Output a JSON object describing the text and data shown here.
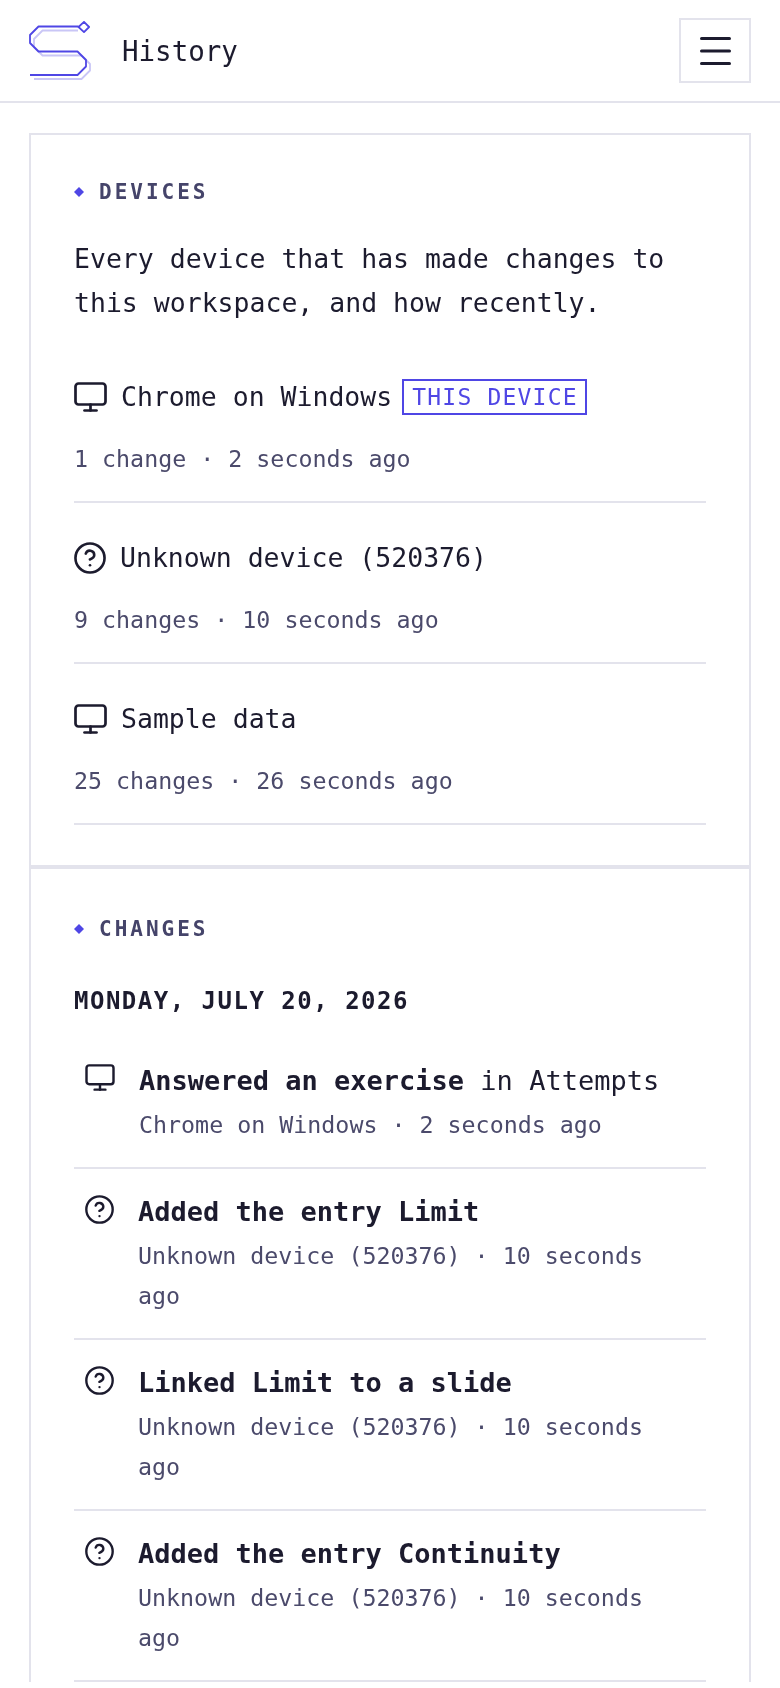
{
  "header": {
    "title": "History"
  },
  "devices": {
    "label": "DEVICES",
    "description": "Every device that has made changes to this workspace, and how recently.",
    "items": [
      {
        "kind": "desktop",
        "name": "Chrome on Windows",
        "badge": "THIS DEVICE",
        "activity": "1 change · 2 seconds ago"
      },
      {
        "kind": "unknown",
        "name": "Unknown device (520376)",
        "activity": "9 changes · 10 seconds ago"
      },
      {
        "kind": "desktop",
        "name": "Sample data",
        "activity": "25 changes · 26 seconds ago"
      }
    ]
  },
  "changes": {
    "label": "CHANGES",
    "groups": [
      {
        "date": "MONDAY, JULY 20, 2026",
        "items": [
          {
            "kind": "desktop",
            "action": "Answered an exercise",
            "target": "in Attempts",
            "details": "Chrome on Windows · 2 seconds ago"
          },
          {
            "kind": "unknown",
            "action": "Added the entry Limit",
            "details": "Unknown device (520376) · 10 seconds ago"
          },
          {
            "kind": "unknown",
            "action": "Linked Limit to a slide",
            "details": "Unknown device (520376) · 10 seconds ago"
          },
          {
            "kind": "unknown",
            "action": "Added the entry Continuity",
            "details": "Unknown device (520376) · 10 seconds ago"
          }
        ]
      }
    ]
  }
}
